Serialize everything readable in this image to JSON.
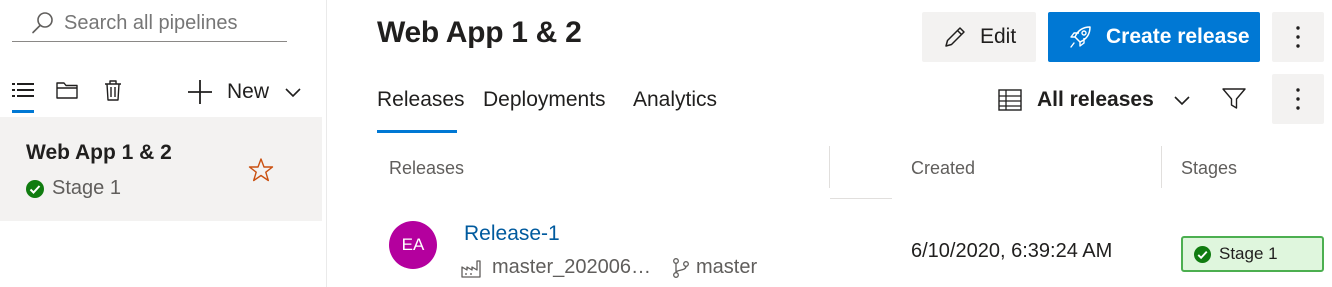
{
  "sidebar": {
    "search": {
      "placeholder": "Search all pipelines",
      "icon": "search-icon"
    },
    "toolbar": {
      "icons": [
        "list-icon",
        "folder-icon",
        "trash-icon"
      ],
      "new_label": "New"
    },
    "pipelines": [
      {
        "name": "Web App 1 & 2",
        "stage": "Stage 1",
        "stage_status": "succeeded",
        "favorite": false
      }
    ]
  },
  "header": {
    "title": "Web App 1 & 2",
    "edit_label": "Edit",
    "create_release_label": "Create release"
  },
  "tabs": [
    {
      "label": "Releases",
      "active": true
    },
    {
      "label": "Deployments",
      "active": false
    },
    {
      "label": "Analytics",
      "active": false
    }
  ],
  "view": {
    "selected": "All releases"
  },
  "table": {
    "columns": [
      "Releases",
      "Created",
      "Stages"
    ],
    "rows": [
      {
        "avatar_initials": "EA",
        "release": "Release-1",
        "artifact": "master_202006…",
        "branch": "master",
        "created": "6/10/2020, 6:39:24 AM",
        "stage": "Stage 1",
        "stage_status": "succeeded"
      }
    ]
  },
  "colors": {
    "accent": "#0078d4",
    "avatar": "#b4009e",
    "success": "#107c10",
    "success_bg": "#dff6dd",
    "star": "#ca5010",
    "link": "#005a9e"
  }
}
